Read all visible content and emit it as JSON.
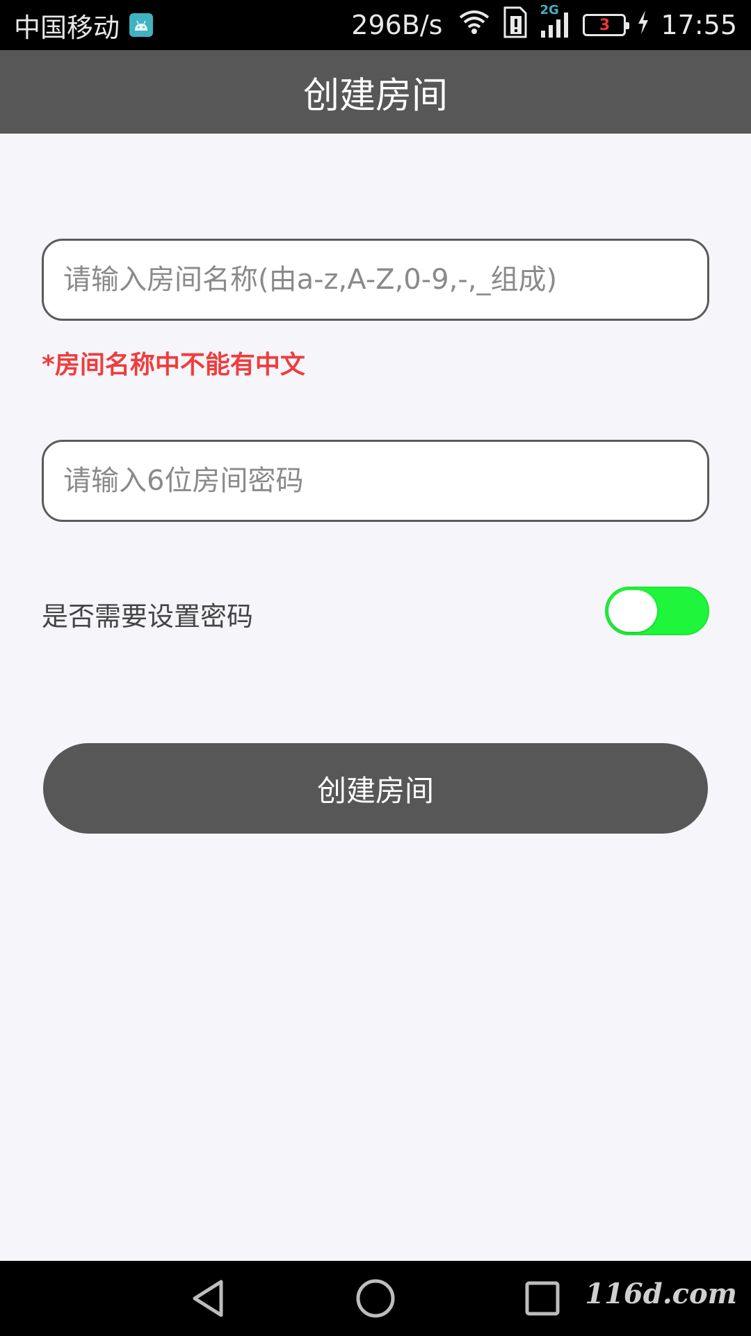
{
  "status_bar": {
    "carrier": "中国移动",
    "speed": "296B/s",
    "network": "2G",
    "battery_level": "3",
    "time": "17:55"
  },
  "header": {
    "title": "创建房间"
  },
  "form": {
    "room_name_placeholder": "请输入房间名称(由a-z,A-Z,0-9,-,_组成)",
    "room_name_value": "",
    "warning": "*房间名称中不能有中文",
    "password_placeholder": "请输入6位房间密码",
    "password_value": "",
    "password_toggle_label": "是否需要设置密码",
    "submit_label": "创建房间"
  },
  "watermark": "116d.com",
  "colors": {
    "header_bg": "#575757",
    "page_bg": "#f5f5fa",
    "warning": "#f03c3c",
    "toggle_track": "#1ff53a"
  }
}
